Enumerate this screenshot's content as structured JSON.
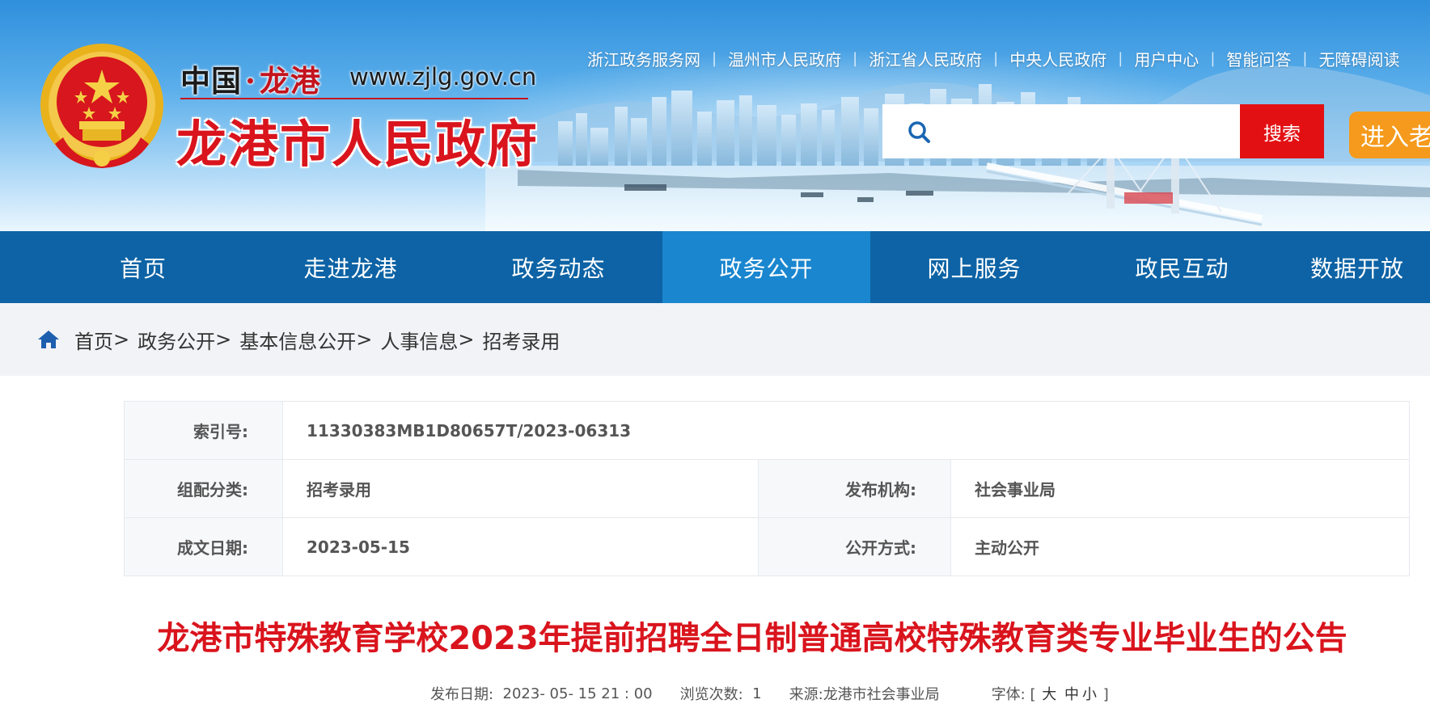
{
  "header": {
    "site_cn_a": "中国",
    "site_cn_dot": "·",
    "site_cn_b": "龙港",
    "site_url": "www.zjlg.gov.cn",
    "site_title": "龙港市人民政府",
    "top_links": [
      "浙江政务服务网",
      "温州市人民政府",
      "浙江省人民政府",
      "中央人民政府",
      "用户中心",
      "智能问答",
      "无障碍阅读"
    ],
    "search": {
      "placeholder": "",
      "button_label": "搜索"
    },
    "elder_mode_label": "进入老"
  },
  "nav": {
    "items": [
      "首页",
      "走进龙港",
      "政务动态",
      "政务公开",
      "网上服务",
      "政民互动",
      "数据开放"
    ],
    "active_index": 3
  },
  "breadcrumb": {
    "items": [
      "首页",
      "政务公开",
      "基本信息公开",
      "人事信息",
      "招考录用"
    ],
    "separator": ">"
  },
  "meta": {
    "index_label": "索引号:",
    "index_value": "11330383MB1D80657T/2023-06313",
    "category_label": "组配分类:",
    "category_value": "招考录用",
    "publisher_label": "发布机构:",
    "publisher_value": "社会事业局",
    "date_label": "成文日期:",
    "date_value": "2023-05-15",
    "open_label": "公开方式:",
    "open_value": "主动公开"
  },
  "article": {
    "title": "龙港市特殊教育学校2023年提前招聘全日制普通高校特殊教育类专业毕业生的公告",
    "publish_label": "发布日期:",
    "publish_value": "2023- 05- 15 21 : 00",
    "views_label": "浏览次数:",
    "views_value": "1",
    "source_label": "来源:",
    "source_value": "龙港市社会事业局",
    "font_label": "字体:",
    "font_open": "[",
    "font_large": "大",
    "font_medium": "中",
    "font_small": "小",
    "font_close": "]"
  },
  "colors": {
    "nav_bg": "#0d63a5",
    "nav_active": "#1a86cf",
    "title_red": "#d9141d",
    "search_btn": "#e31013",
    "elder_btn": "#f59a1c"
  }
}
